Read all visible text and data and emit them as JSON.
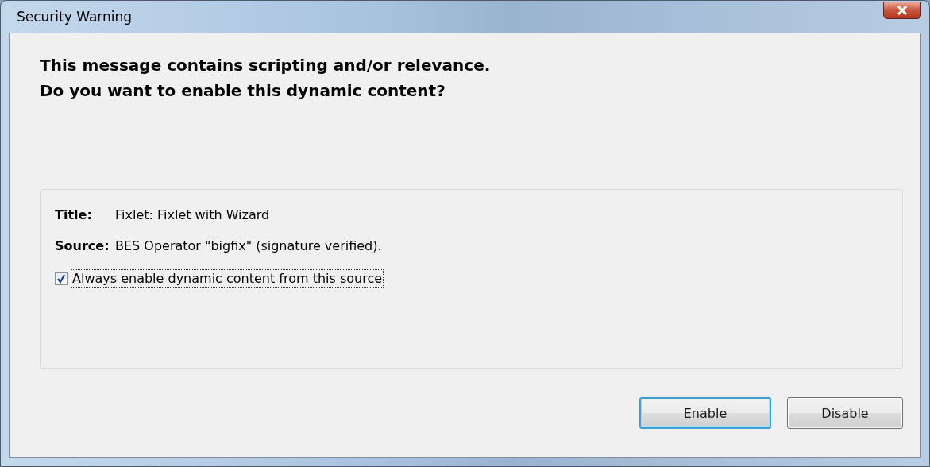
{
  "window": {
    "title": "Security Warning"
  },
  "heading": [
    "This message contains scripting and/or relevance.",
    "Do you want to enable this dynamic content?"
  ],
  "details": [
    {
      "label": "Title:",
      "value": "Fixlet: Fixlet with Wizard"
    },
    {
      "label": "Source:",
      "value": "BES Operator \"bigfix\" (signature verified)."
    }
  ],
  "option": {
    "label": "Always enable dynamic content from this source",
    "checked": true
  },
  "buttons": [
    {
      "label": "Enable",
      "default": true
    },
    {
      "label": "Disable",
      "default": false
    }
  ]
}
